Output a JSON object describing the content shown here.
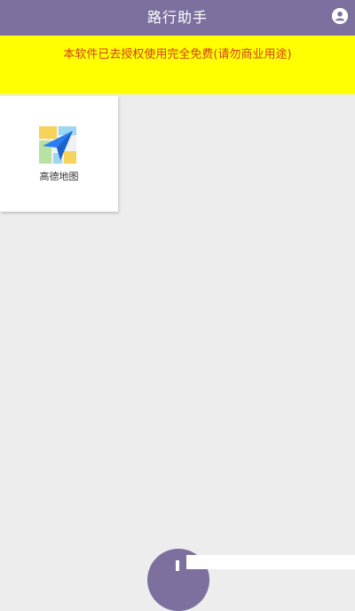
{
  "header": {
    "title": "路行助手",
    "user_icon": "user-circle-icon"
  },
  "notice": {
    "text": "本软件已去授权使用完全免费(请勿商业用途)"
  },
  "apps": [
    {
      "label": "高德地图",
      "icon": "amap-icon"
    }
  ],
  "fab": {
    "icon": "plus-icon"
  },
  "colors": {
    "header_bg": "#7d6f9e",
    "notice_bg": "#ffff00",
    "notice_text": "#d3401c",
    "page_bg": "#ededed",
    "tile_bg": "#ffffff"
  }
}
